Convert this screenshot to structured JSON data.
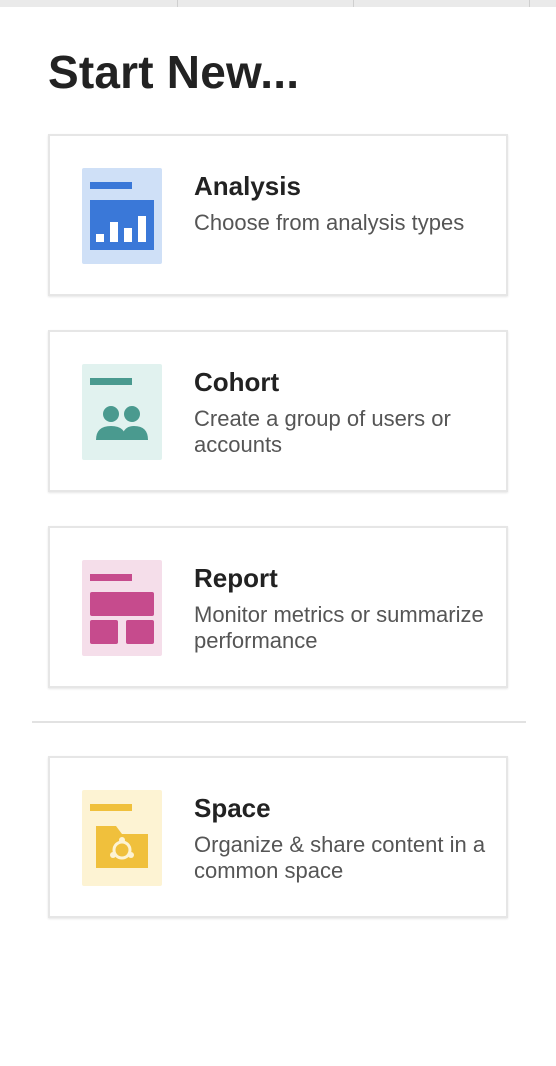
{
  "page": {
    "title": "Start New..."
  },
  "options": [
    {
      "key": "analysis",
      "title": "Analysis",
      "description": "Choose from analysis types",
      "icon": "analysis-chart-icon",
      "tile_color": "#cfe0f7",
      "accent_color": "#3a78d8"
    },
    {
      "key": "cohort",
      "title": "Cohort",
      "description": "Create a group of users or accounts",
      "icon": "users-group-icon",
      "tile_color": "#e1f2ef",
      "accent_color": "#4a9a8f"
    },
    {
      "key": "report",
      "title": "Report",
      "description": "Monitor metrics or summarize performance",
      "icon": "report-layout-icon",
      "tile_color": "#f5deea",
      "accent_color": "#c64b8d"
    },
    {
      "key": "space",
      "title": "Space",
      "description": "Organize & share content in a common space",
      "icon": "folder-icon",
      "tile_color": "#fdf3d3",
      "accent_color": "#f0c03c"
    }
  ]
}
